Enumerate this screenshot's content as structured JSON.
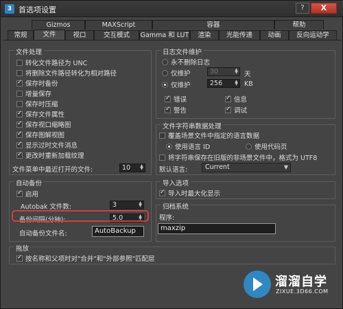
{
  "window": {
    "title": "首选项设置",
    "help": "?",
    "close": "X"
  },
  "tabs_top": [
    "Gizmos",
    "MAXScript",
    "容器",
    "帮助"
  ],
  "tabs_bottom": [
    "常规",
    "文件",
    "视口",
    "交互模式",
    "Gamma 和 LUT",
    "渲染",
    "光能传递",
    "动画",
    "反向运动学"
  ],
  "active_tab": "文件",
  "file_handling": {
    "title": "文件处理",
    "items": [
      {
        "label": "转化文件路径为 UNC",
        "checked": false
      },
      {
        "label": "将删除文件路径转化为相对路径",
        "checked": false
      },
      {
        "label": "保存时备份",
        "checked": true
      },
      {
        "label": "增量保存",
        "checked": false
      },
      {
        "label": "保存时压缩",
        "checked": false
      },
      {
        "label": "保存文件属性",
        "checked": true
      },
      {
        "label": "保存视口缩略图",
        "checked": true
      },
      {
        "label": "保存图解视图",
        "checked": true
      },
      {
        "label": "显示过时文件消息",
        "checked": true
      },
      {
        "label": "更改时重新加载纹理",
        "checked": true
      }
    ],
    "recent_label": "文件菜单中最近打开的文件:",
    "recent_value": "10"
  },
  "log": {
    "title": "日志文件维护",
    "never_delete": "永不删除日志",
    "keep_only": "仅维护",
    "days_value": "30",
    "days_unit": "天",
    "size_value": "256",
    "size_unit": "KB",
    "errors": "错误",
    "info": "信息",
    "warnings": "警告",
    "debug": "调试"
  },
  "string_data": {
    "title": "文件字符串数据处理",
    "override_label": "覆盖场景文件中指定的语言数据",
    "use_language_id": "使用语言 ID",
    "use_code_page": "使用代码页",
    "save_utf8": "将字符串保存在旧版的非场景文件中，格式为 UTF8",
    "default_lang_label": "默认语言:",
    "default_lang_value": "Current"
  },
  "autobackup": {
    "title": "自动备份",
    "enable": "启用",
    "count_label": "Autobak 文件数:",
    "count_value": "3",
    "interval_label": "备份间隔(分钟):",
    "interval_value": "5.0",
    "filename_label": "自动备份文件名:",
    "filename_value": "AutoBackup"
  },
  "import": {
    "title": "导入选项",
    "max_label": "导入时最大化显示"
  },
  "archive": {
    "title": "归档系统",
    "program_label": "程序:",
    "program_value": "maxzip"
  },
  "xref": {
    "title": "拖放",
    "label": "按名称和父项时对\"合并\"和\"外部参照\"匹配层"
  },
  "watermark": {
    "name": "溜溜自学",
    "url": "ZIXUE.3D66.COM"
  }
}
